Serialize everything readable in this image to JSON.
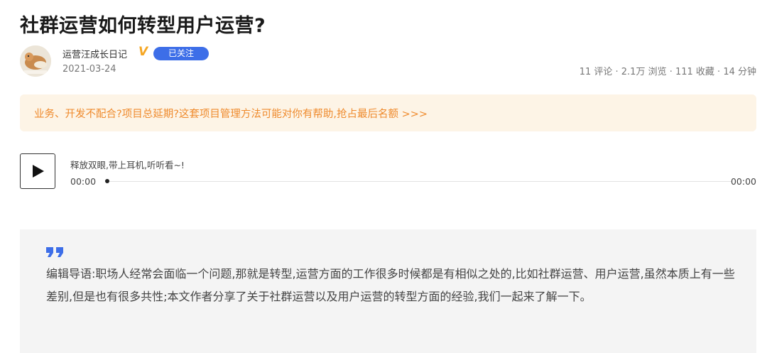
{
  "article": {
    "title": "社群运营如何转型用户运营?"
  },
  "author": {
    "name": "运营汪成长日记",
    "verified_mark": "V",
    "follow_label": "已关注",
    "date": "2021-03-24"
  },
  "stats": {
    "text": "11 评论 · 2.1万 浏览 · 111 收藏 · 14 分钟"
  },
  "promo": {
    "text": "业务、开发不配合?项目总延期?这套项目管理方法可能对你有帮助,抢占最后名额 >>>"
  },
  "audio": {
    "label": "释放双眼,带上耳机,听听看~!",
    "current_time": "00:00",
    "total_time": "00:00",
    "progress": 0,
    "play_icon": "play-icon"
  },
  "guide": {
    "quote_icon": "quote-icon",
    "text": "编辑导语:职场人经常会面临一个问题,那就是转型,运营方面的工作很多时候都是有相似之处的,比如社群运营、用户运营,虽然本质上有一些差别,但是也有很多共性;本文作者分享了关于社群运营以及用户运营的转型方面的经验,我们一起来了解一下。"
  },
  "colors": {
    "follow_button": "#3d6ee8",
    "promo_background": "#fdf4e6",
    "promo_text": "#ef8a2c",
    "verified": "#f5a623",
    "quote": "#3d6ee8",
    "guide_background": "#f4f4f4"
  }
}
